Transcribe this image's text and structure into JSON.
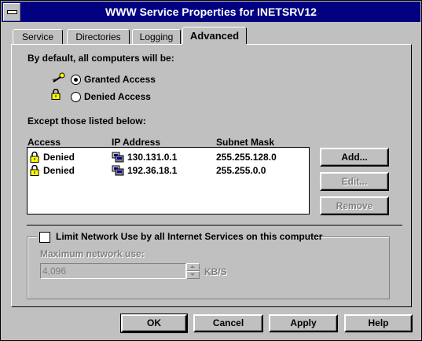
{
  "window": {
    "title": "WWW Service Properties for INETSRV12"
  },
  "tabs": [
    {
      "label": "Service"
    },
    {
      "label": "Directories"
    },
    {
      "label": "Logging"
    },
    {
      "label": "Advanced",
      "active": true
    }
  ],
  "advanced": {
    "default_label": "By default, all computers will be:",
    "granted_label": "Granted Access",
    "denied_label": "Denied Access",
    "selected": "granted",
    "except_label": "Except those listed below:",
    "columns": [
      "Access",
      "IP Address",
      "Subnet Mask"
    ],
    "rows": [
      {
        "access": "Denied",
        "ip": "130.131.0.1",
        "mask": "255.255.128.0"
      },
      {
        "access": "Denied",
        "ip": "192.36.18.1",
        "mask": "255.255.0.0"
      }
    ],
    "add_button": "Add...",
    "edit_button": "Edit...",
    "remove_button": "Remove",
    "limit_checkbox_label": "Limit Network Use by all Internet Services on this computer",
    "limit_checked": false,
    "max_use_label": "Maximum network use:",
    "max_use_value": "4,096",
    "max_use_unit": "KB/S"
  },
  "footer": {
    "ok": "OK",
    "cancel": "Cancel",
    "apply": "Apply",
    "help": "Help"
  },
  "icons": {
    "lock": "padlock-icon",
    "key": "key-icon",
    "computer": "computer-icon"
  }
}
